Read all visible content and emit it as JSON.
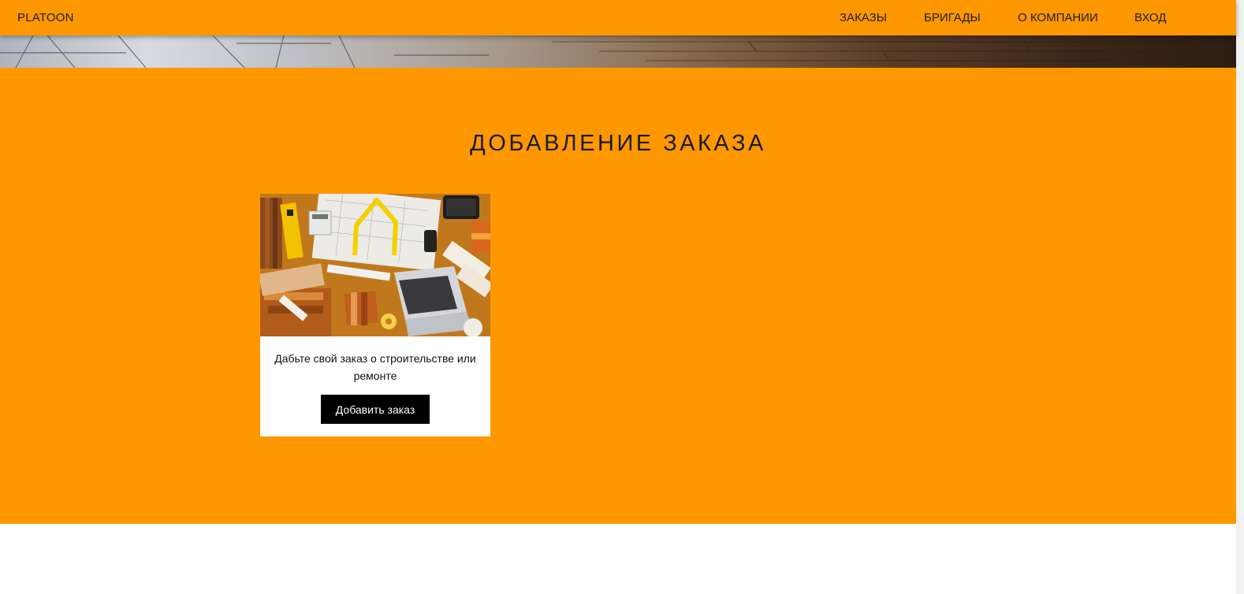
{
  "header": {
    "brand": "PLATOON",
    "nav": {
      "orders": "ЗАКАЗЫ",
      "brigades": "БРИГАДЫ",
      "about": "О КОМПАНИИ",
      "login": "ВХОД"
    }
  },
  "main": {
    "title": "ДОБАВЛЕНИЕ ЗАКАЗА",
    "card": {
      "description": "Дабьте свой заказ о строительстве или ремонте",
      "button_label": "Добавить заказ",
      "image_icon": "construction-workspace-image"
    }
  },
  "colors": {
    "accent": "#ff9800",
    "button": "#000000",
    "card_background": "#ffffff"
  }
}
